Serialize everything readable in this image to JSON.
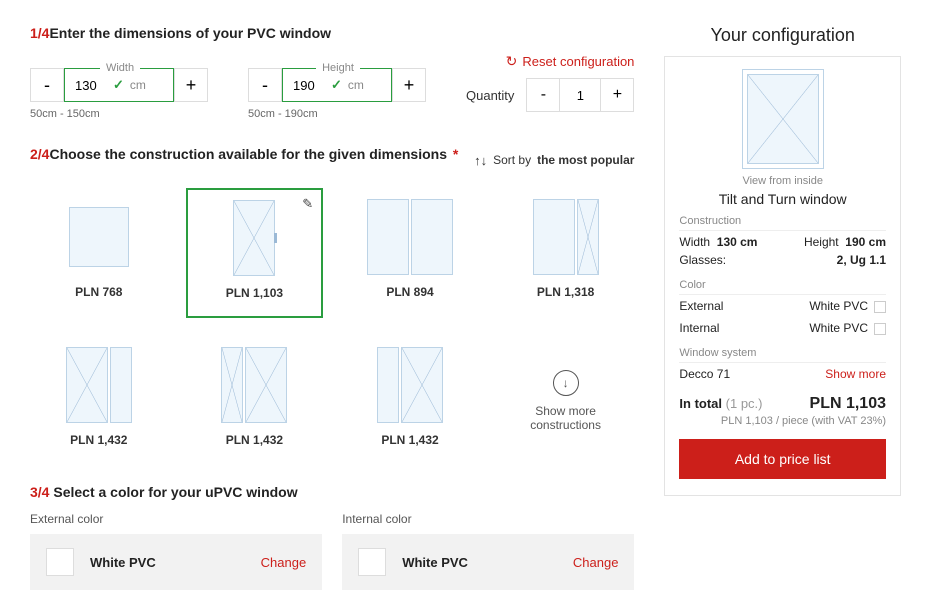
{
  "step1": {
    "num": "1/4",
    "title": "Enter the dimensions of your PVC window",
    "width_label": "Width",
    "width_value": "130",
    "width_unit": "cm",
    "width_range": "50cm - 150cm",
    "height_label": "Height",
    "height_value": "190",
    "height_unit": "cm",
    "height_range": "50cm - 190cm",
    "reset_label": "Reset configuration",
    "quantity_label": "Quantity",
    "quantity_value": "1"
  },
  "step2": {
    "num": "2/4",
    "title": "Choose the construction available for the given dimensions",
    "sort_prefix": "Sort by",
    "sort_value": "the most popular",
    "show_more": "Show more constructions",
    "cards": [
      {
        "price": "PLN 768"
      },
      {
        "price": "PLN 1,103"
      },
      {
        "price": "PLN 894"
      },
      {
        "price": "PLN 1,318"
      },
      {
        "price": "PLN 1,432"
      },
      {
        "price": "PLN 1,432"
      },
      {
        "price": "PLN 1,432"
      }
    ]
  },
  "step3": {
    "num": "3/4",
    "title": " Select a color for your uPVC window",
    "external_label": "External color",
    "internal_label": "Internal color",
    "external_value": "White PVC",
    "internal_value": "White PVC",
    "change_label": "Change"
  },
  "config": {
    "title": "Your configuration",
    "view_caption": "View from inside",
    "product_name": "Tilt and Turn window",
    "section_construction": "Construction",
    "width_label": "Width",
    "width_value": "130 cm",
    "height_label": "Height",
    "height_value": "190 cm",
    "glasses_label": "Glasses:",
    "glasses_value": "2, Ug 1.1",
    "section_color": "Color",
    "external_label": "External",
    "external_value": "White PVC",
    "internal_label": "Internal",
    "internal_value": "White PVC",
    "section_system": "Window system",
    "system_value": "Decco 71",
    "show_more": "Show more",
    "total_label": "In total",
    "total_qty": "(1 pc.)",
    "total_amount": "PLN 1,103",
    "per_piece": "PLN 1,103 / piece",
    "vat_note": "(with VAT 23%)",
    "add_button": "Add to price list"
  }
}
